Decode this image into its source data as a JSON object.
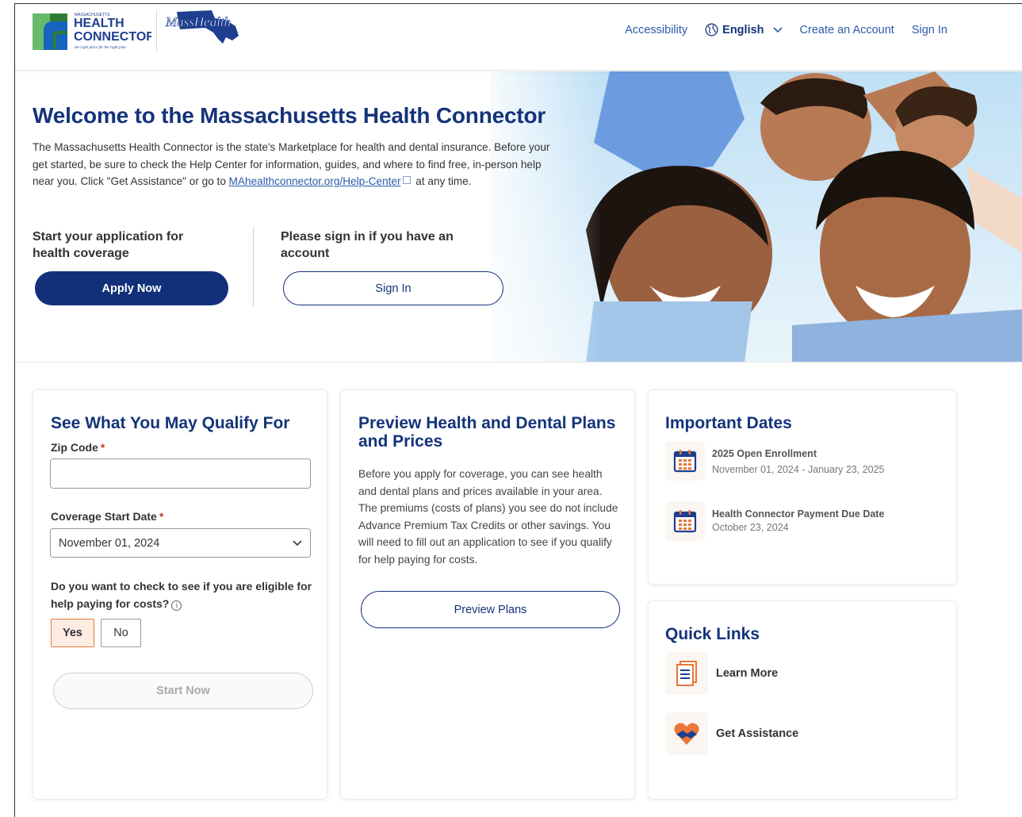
{
  "header": {
    "logo_health_connector": {
      "state": "MASSACHUSETTS",
      "line1": "HEALTH",
      "line2": "CONNECTOR",
      "tagline": "the right place for the right plan"
    },
    "logo_masshealth": "MassHealth",
    "nav": {
      "accessibility": "Accessibility",
      "language": "English",
      "create_account": "Create an Account",
      "sign_in": "Sign In"
    }
  },
  "hero": {
    "title": "Welcome to the Massachusetts Health Connector",
    "description_before": "The Massachusetts Health Connector is the state's Marketplace for health and dental insurance. Before your get started, be sure to check the Help Center for information, guides, and where to find free, in-person help near you. Click \"Get Assistance\" or go to ",
    "description_link": "MAhealthconnector.org/Help-Center",
    "description_after": " at any time.",
    "left_heading": "Start your application for health coverage",
    "apply_button": "Apply Now",
    "right_heading": "Please sign in if you have an account",
    "signin_button": "Sign In"
  },
  "qualify_card": {
    "title": "See What You May Qualify For",
    "zip_label": "Zip Code",
    "zip_value": "",
    "required_mark": "*",
    "coverage_label": "Coverage Start Date",
    "coverage_value": "November 01, 2024",
    "question": "Do you want to check to see if you are eligible for help paying for costs?",
    "info_symbol": "i",
    "yes_label": "Yes",
    "no_label": "No",
    "selected": "Yes",
    "start_button": "Start Now"
  },
  "preview_card": {
    "title": "Preview Health and Dental Plans and Prices",
    "description": "Before you apply for coverage, you can see health and dental plans and prices available in your area. The premiums (costs of plans) you see do not include Advance Premium Tax Credits or other savings. You will need to fill out an application to see if you qualify for help paying for costs.",
    "button": "Preview Plans"
  },
  "important_dates": {
    "title": "Important Dates",
    "items": [
      {
        "title": "2025 Open Enrollment",
        "date": "November 01, 2024 - January 23, 2025",
        "icon": "calendar-icon"
      },
      {
        "title": "Health Connector Payment Due Date",
        "date": "October 23, 2024",
        "icon": "calendar-icon"
      }
    ]
  },
  "quick_links": {
    "title": "Quick Links",
    "items": [
      {
        "label": "Learn More",
        "icon": "document-icon"
      },
      {
        "label": "Get Assistance",
        "icon": "heart-hands-icon"
      }
    ]
  },
  "colors": {
    "navy": "#14337a",
    "link_blue": "#2d5ba8",
    "orange": "#e9773a",
    "calendar_blue": "#1e3f8f",
    "required_red": "#c0392b"
  }
}
